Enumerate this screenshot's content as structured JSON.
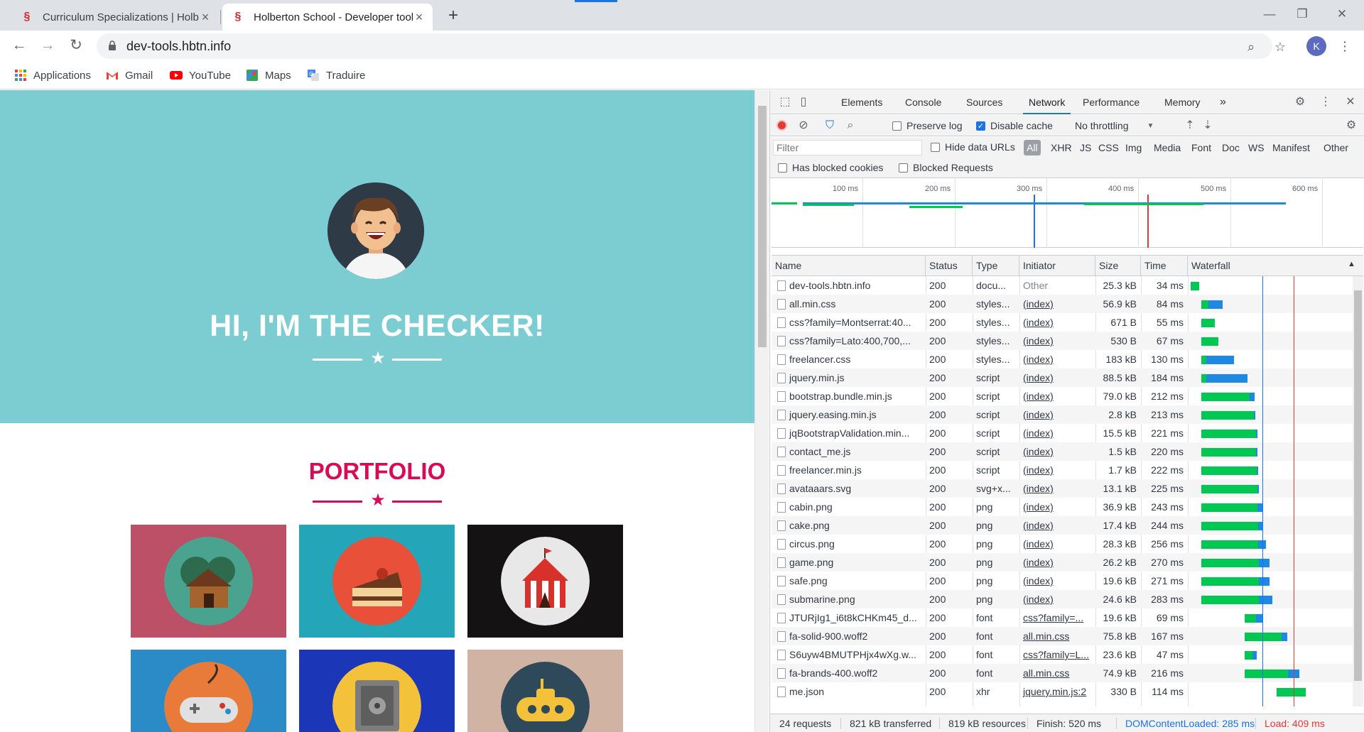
{
  "browser": {
    "tabs": [
      {
        "title": "Curriculum Specializations | Holberton",
        "active": false
      },
      {
        "title": "Holberton School - Developer tools",
        "active": true
      }
    ],
    "new_tab_label": "+",
    "window_controls": {
      "minimize": "—",
      "restore": "❐",
      "close": "✕"
    },
    "url": "dev-tools.hbtn.info",
    "profile_initial": "K",
    "bookmarks": [
      "Applications",
      "Gmail",
      "YouTube",
      "Maps",
      "Traduire"
    ]
  },
  "page": {
    "hero_title": "HI, I'M THE CHECKER!",
    "section_title": "PORTFOLIO",
    "colors": {
      "hero_bg": "#7ccdd2",
      "accent": "#d90b56"
    },
    "portfolio_items": [
      {
        "icon": "cabin-icon",
        "bg": "#bb5066",
        "circle": "#4aa38e"
      },
      {
        "icon": "cake-icon",
        "bg": "#25a5b8",
        "circle": "#e8503a"
      },
      {
        "icon": "circus-icon",
        "bg": "#141212",
        "circle": "#e8e8e8"
      },
      {
        "icon": "game-icon",
        "bg": "#2b8bc6",
        "circle": "#e87b3a"
      },
      {
        "icon": "safe-icon",
        "bg": "#1c36b8",
        "circle": "#f4c13a"
      },
      {
        "icon": "submarine-icon",
        "bg": "#d0b3a2",
        "circle": "#2e4a5a"
      }
    ]
  },
  "devtools": {
    "tabs": [
      "Elements",
      "Console",
      "Sources",
      "Network",
      "Performance",
      "Memory"
    ],
    "active_tab": "Network",
    "more_tabs": "»",
    "toolbar": {
      "preserve_log": "Preserve log",
      "disable_cache": "Disable cache",
      "throttling": "No throttling"
    },
    "filter": {
      "placeholder": "Filter",
      "hide_data_urls": "Hide data URLs",
      "types": [
        "All",
        "XHR",
        "JS",
        "CSS",
        "Img",
        "Media",
        "Font",
        "Doc",
        "WS",
        "Manifest",
        "Other"
      ],
      "has_blocked_cookies": "Has blocked cookies",
      "blocked_requests": "Blocked Requests"
    },
    "overview_ticks": [
      "100 ms",
      "200 ms",
      "300 ms",
      "400 ms",
      "500 ms",
      "600 ms"
    ],
    "columns": [
      "Name",
      "Status",
      "Type",
      "Initiator",
      "Size",
      "Time",
      "Waterfall"
    ],
    "requests": [
      {
        "name": "dev-tools.hbtn.info",
        "status": "200",
        "type": "docu...",
        "initiator": "Other",
        "size": "25.3 kB",
        "time": "34 ms",
        "start": 0,
        "wait": 34,
        "dl": 0
      },
      {
        "name": "all.min.css",
        "status": "200",
        "type": "styles...",
        "initiator": "(index)",
        "size": "56.9 kB",
        "time": "84 ms",
        "start": 42,
        "wait": 28,
        "dl": 56
      },
      {
        "name": "css?family=Montserrat:40...",
        "status": "200",
        "type": "styles...",
        "initiator": "(index)",
        "size": "671 B",
        "time": "55 ms",
        "start": 42,
        "wait": 55,
        "dl": 0
      },
      {
        "name": "css?family=Lato:400,700,...",
        "status": "200",
        "type": "styles...",
        "initiator": "(index)",
        "size": "530 B",
        "time": "67 ms",
        "start": 42,
        "wait": 67,
        "dl": 0
      },
      {
        "name": "freelancer.css",
        "status": "200",
        "type": "styles...",
        "initiator": "(index)",
        "size": "183 kB",
        "time": "130 ms",
        "start": 42,
        "wait": 20,
        "dl": 110
      },
      {
        "name": "jquery.min.js",
        "status": "200",
        "type": "script",
        "initiator": "(index)",
        "size": "88.5 kB",
        "time": "184 ms",
        "start": 42,
        "wait": 20,
        "dl": 164
      },
      {
        "name": "bootstrap.bundle.min.js",
        "status": "200",
        "type": "script",
        "initiator": "(index)",
        "size": "79.0 kB",
        "time": "212 ms",
        "start": 42,
        "wait": 192,
        "dl": 20
      },
      {
        "name": "jquery.easing.min.js",
        "status": "200",
        "type": "script",
        "initiator": "(index)",
        "size": "2.8 kB",
        "time": "213 ms",
        "start": 42,
        "wait": 210,
        "dl": 3
      },
      {
        "name": "jqBootstrapValidation.min...",
        "status": "200",
        "type": "script",
        "initiator": "(index)",
        "size": "15.5 kB",
        "time": "221 ms",
        "start": 42,
        "wait": 218,
        "dl": 3
      },
      {
        "name": "contact_me.js",
        "status": "200",
        "type": "script",
        "initiator": "(index)",
        "size": "1.5 kB",
        "time": "220 ms",
        "start": 42,
        "wait": 217,
        "dl": 3
      },
      {
        "name": "freelancer.min.js",
        "status": "200",
        "type": "script",
        "initiator": "(index)",
        "size": "1.7 kB",
        "time": "222 ms",
        "start": 42,
        "wait": 219,
        "dl": 3
      },
      {
        "name": "avataaars.svg",
        "status": "200",
        "type": "svg+x...",
        "initiator": "(index)",
        "size": "13.1 kB",
        "time": "225 ms",
        "start": 42,
        "wait": 222,
        "dl": 3
      },
      {
        "name": "cabin.png",
        "status": "200",
        "type": "png",
        "initiator": "(index)",
        "size": "36.9 kB",
        "time": "243 ms",
        "start": 42,
        "wait": 222,
        "dl": 21
      },
      {
        "name": "cake.png",
        "status": "200",
        "type": "png",
        "initiator": "(index)",
        "size": "17.4 kB",
        "time": "244 ms",
        "start": 42,
        "wait": 225,
        "dl": 19
      },
      {
        "name": "circus.png",
        "status": "200",
        "type": "png",
        "initiator": "(index)",
        "size": "28.3 kB",
        "time": "256 ms",
        "start": 42,
        "wait": 225,
        "dl": 31
      },
      {
        "name": "game.png",
        "status": "200",
        "type": "png",
        "initiator": "(index)",
        "size": "26.2 kB",
        "time": "270 ms",
        "start": 42,
        "wait": 228,
        "dl": 42
      },
      {
        "name": "safe.png",
        "status": "200",
        "type": "png",
        "initiator": "(index)",
        "size": "19.6 kB",
        "time": "271 ms",
        "start": 42,
        "wait": 228,
        "dl": 43
      },
      {
        "name": "submarine.png",
        "status": "200",
        "type": "png",
        "initiator": "(index)",
        "size": "24.6 kB",
        "time": "283 ms",
        "start": 42,
        "wait": 228,
        "dl": 55
      },
      {
        "name": "JTURjIg1_i6t8kCHKm45_d...",
        "status": "200",
        "type": "font",
        "initiator": "css?family=...",
        "size": "19.6 kB",
        "time": "69 ms",
        "start": 215,
        "wait": 45,
        "dl": 24
      },
      {
        "name": "fa-solid-900.woff2",
        "status": "200",
        "type": "font",
        "initiator": "all.min.css",
        "size": "75.8 kB",
        "time": "167 ms",
        "start": 215,
        "wait": 145,
        "dl": 22
      },
      {
        "name": "S6uyw4BMUTPHjx4wXg.w...",
        "status": "200",
        "type": "font",
        "initiator": "css?family=L...",
        "size": "23.6 kB",
        "time": "47 ms",
        "start": 215,
        "wait": 30,
        "dl": 17
      },
      {
        "name": "fa-brands-400.woff2",
        "status": "200",
        "type": "font",
        "initiator": "all.min.css",
        "size": "74.9 kB",
        "time": "216 ms",
        "start": 215,
        "wait": 170,
        "dl": 46
      },
      {
        "name": "me.json",
        "status": "200",
        "type": "xhr",
        "initiator": "jquery.min.js:2",
        "size": "330 B",
        "time": "114 ms",
        "start": 342,
        "wait": 114,
        "dl": 0
      }
    ],
    "dom_content_loaded_ms": 285,
    "load_ms": 409,
    "status": {
      "requests": "24 requests",
      "transferred": "821 kB transferred",
      "resources": "819 kB resources",
      "finish": "Finish: 520 ms",
      "dom": "DOMContentLoaded: 285 ms",
      "load": "Load: 409 ms"
    },
    "colors": {
      "waiting": "#00c853",
      "download": "#1e88e5",
      "dom_line": "#1a73e8",
      "load_line": "#e53935"
    }
  }
}
